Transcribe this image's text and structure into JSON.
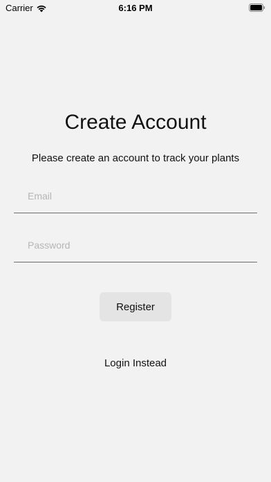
{
  "status_bar": {
    "carrier": "Carrier",
    "time": "6:16 PM",
    "icons": [
      "wifi-icon",
      "battery-icon"
    ]
  },
  "header": {
    "title": "Create Account",
    "subtitle": "Please create an account to track your plants"
  },
  "form": {
    "email": {
      "placeholder": "Email",
      "value": ""
    },
    "password": {
      "placeholder": "Password",
      "value": ""
    },
    "register_label": "Register",
    "login_label": "Login Instead"
  },
  "colors": {
    "background": "#f2f2f2",
    "button_bg": "#e4e4e4",
    "placeholder": "#b5b5b5",
    "underline": "#6d6d6d"
  }
}
